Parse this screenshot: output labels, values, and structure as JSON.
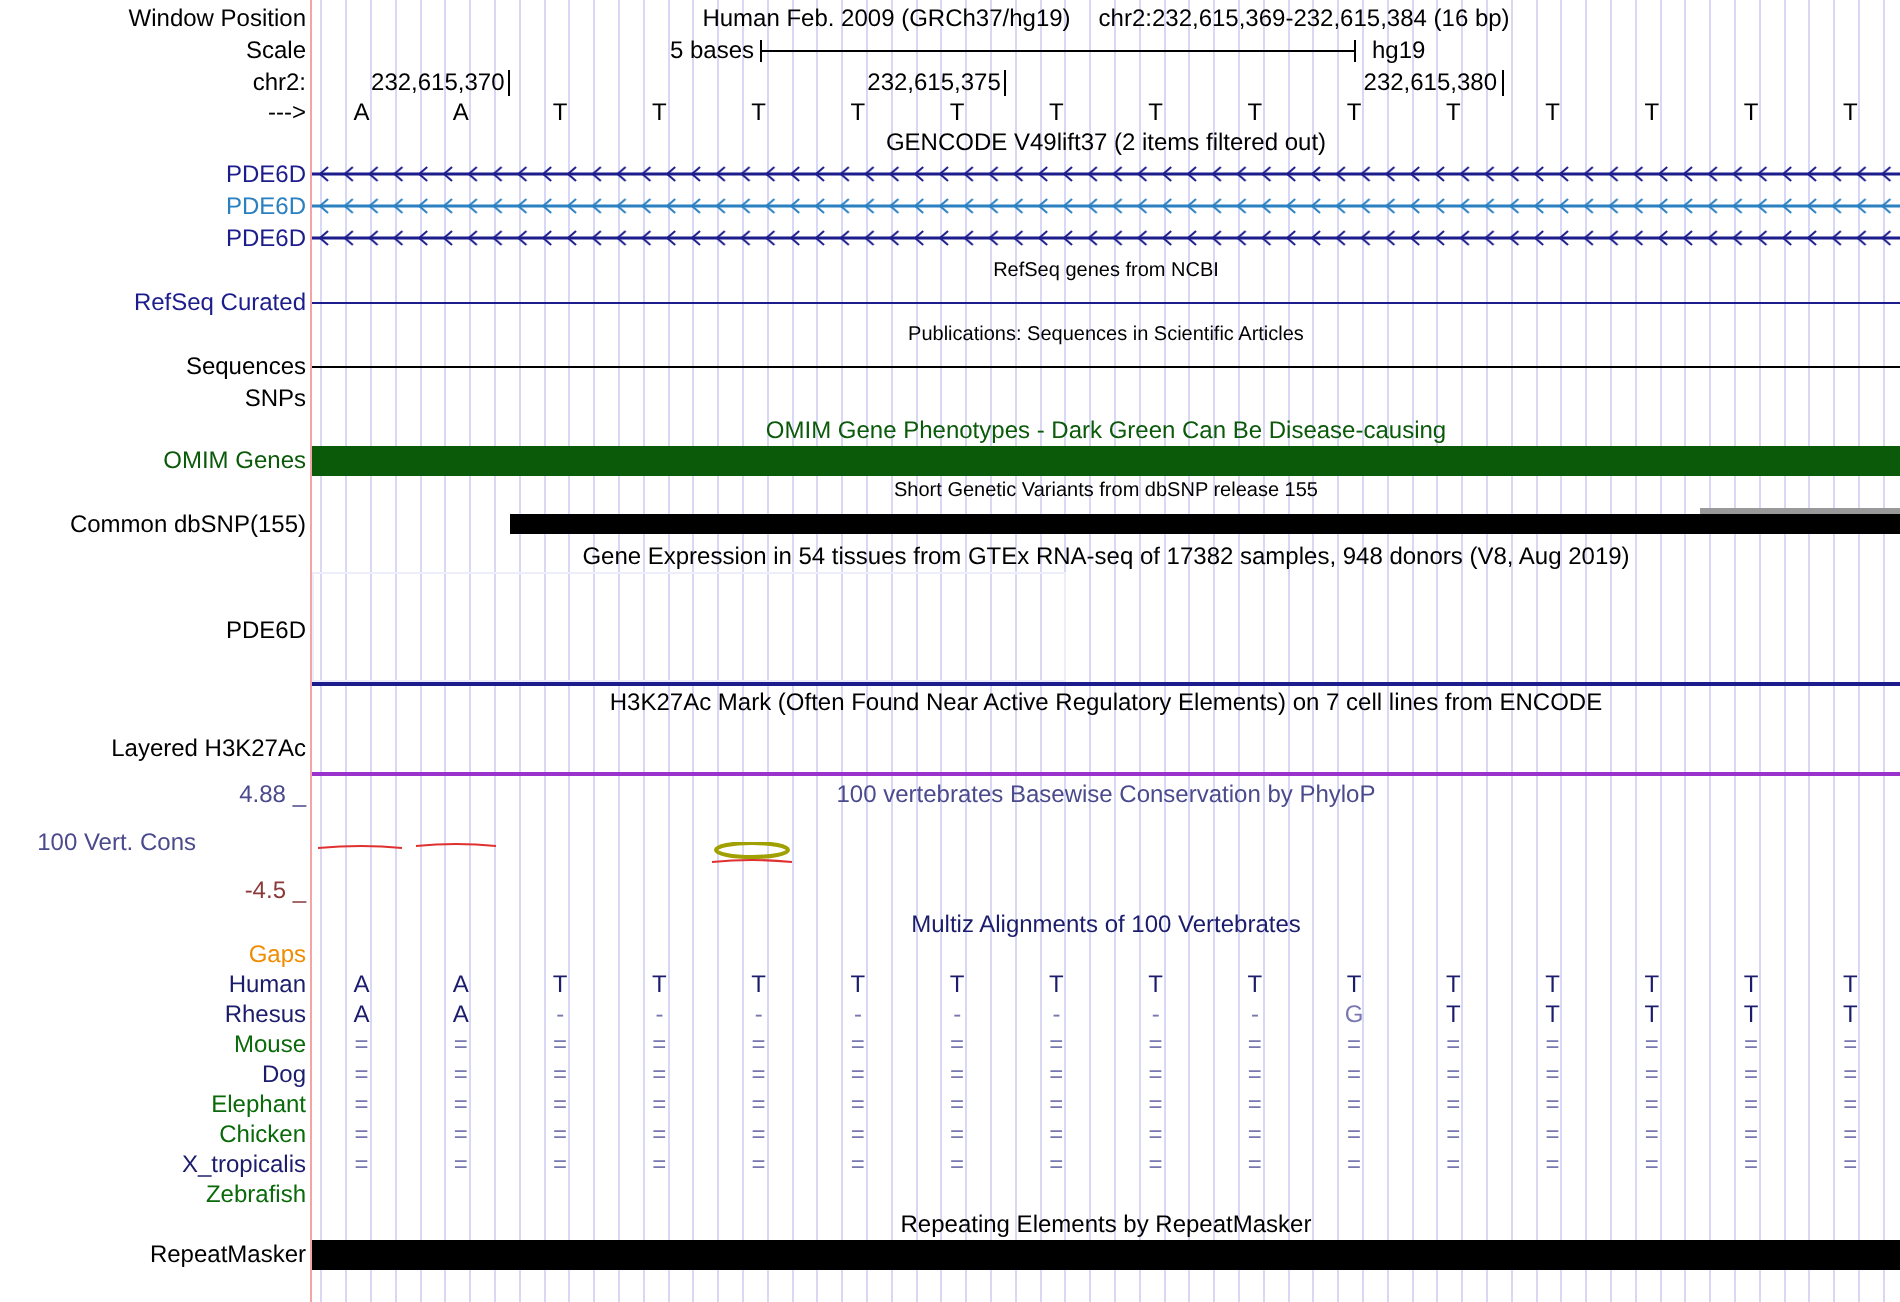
{
  "header": {
    "window_position_label": "Window Position",
    "assembly_title": "Human Feb. 2009 (GRCh37/hg19)",
    "position": "chr2:232,615,369-232,615,384 (16 bp)",
    "scale_label": "Scale",
    "scale_text": "5 bases",
    "assembly": "hg19",
    "chrom_label": "chr2:",
    "positions": [
      "232,615,370",
      "232,615,375",
      "232,615,380"
    ],
    "strand_label": "--->",
    "bases": [
      "A",
      "A",
      "T",
      "T",
      "T",
      "T",
      "T",
      "T",
      "T",
      "T",
      "T",
      "T",
      "T",
      "T",
      "T",
      "T"
    ]
  },
  "tracks": [
    {
      "kind": "gene",
      "title": "GENCODE V49lift37 (2 items filtered out)",
      "color": "#000000",
      "items": [
        {
          "label": "PDE6D",
          "color": "#1c1c8c"
        },
        {
          "label": "PDE6D",
          "color": "#2a80c0"
        },
        {
          "label": "PDE6D",
          "color": "#1c1c8c"
        }
      ]
    },
    {
      "kind": "line",
      "title": "RefSeq genes from NCBI",
      "color": "#000000",
      "rows": [
        {
          "label": "RefSeq Curated",
          "color": "#1c1c8c",
          "line": true
        }
      ]
    },
    {
      "kind": "line",
      "title": "Publications: Sequences in Scientific Articles",
      "color": "#000000",
      "rows": [
        {
          "label": "Sequences",
          "color": "#000000",
          "line": true
        },
        {
          "label": "SNPs",
          "color": "#000000",
          "line": false
        }
      ]
    },
    {
      "kind": "bar",
      "title": "OMIM Gene Phenotypes - Dark Green Can Be Disease-causing",
      "color": "#0a5a0a",
      "label": "OMIM Genes"
    },
    {
      "kind": "snp",
      "title": "Short Genetic Variants from dbSNP release 155",
      "color": "#000000",
      "label": "Common dbSNP(155)"
    },
    {
      "kind": "expression",
      "title": "Gene Expression in 54 tissues from GTEx RNA-seq of 17382 samples, 948 donors (V8, Aug 2019)",
      "color": "#000000",
      "label": "PDE6D"
    },
    {
      "kind": "signal",
      "title": "H3K27Ac Mark (Often Found Near Active Regulatory Elements) on 7 cell lines from ENCODE",
      "color": "#000000",
      "label": "Layered H3K27Ac"
    },
    {
      "kind": "conservation",
      "title": "100 vertebrates Basewise Conservation by PhyloP",
      "color": "#4a4a8c",
      "label": "100 Vert. Cons",
      "max_label": "4.88 _",
      "min_label": "-4.5 _"
    },
    {
      "kind": "alignment",
      "title": "Multiz Alignments of 100 Vertebrates",
      "color": "#1c1c6c",
      "gaps_label": "Gaps",
      "species": [
        {
          "label": "Human",
          "color": "#1c1c6c",
          "bases": [
            "A",
            "A",
            "T",
            "T",
            "T",
            "T",
            "T",
            "T",
            "T",
            "T",
            "T",
            "T",
            "T",
            "T",
            "T",
            "T"
          ]
        },
        {
          "label": "Rhesus",
          "color": "#1c1c6c",
          "bases": [
            "A",
            "A",
            "-",
            "-",
            "-",
            "-",
            "-",
            "-",
            "-",
            "-",
            "G",
            "T",
            "T",
            "T",
            "T",
            "T"
          ]
        },
        {
          "label": "Mouse",
          "color": "#0a6a0a",
          "bases": [
            "=",
            "=",
            "=",
            "=",
            "=",
            "=",
            "=",
            "=",
            "=",
            "=",
            "=",
            "=",
            "=",
            "=",
            "=",
            "="
          ]
        },
        {
          "label": "Dog",
          "color": "#1c1c6c",
          "bases": [
            "=",
            "=",
            "=",
            "=",
            "=",
            "=",
            "=",
            "=",
            "=",
            "=",
            "=",
            "=",
            "=",
            "=",
            "=",
            "="
          ]
        },
        {
          "label": "Elephant",
          "color": "#0a6a0a",
          "bases": [
            "=",
            "=",
            "=",
            "=",
            "=",
            "=",
            "=",
            "=",
            "=",
            "=",
            "=",
            "=",
            "=",
            "=",
            "=",
            "="
          ]
        },
        {
          "label": "Chicken",
          "color": "#0a6a0a",
          "bases": [
            "=",
            "=",
            "=",
            "=",
            "=",
            "=",
            "=",
            "=",
            "=",
            "=",
            "=",
            "=",
            "=",
            "=",
            "=",
            "="
          ]
        },
        {
          "label": "X_tropicalis",
          "color": "#1c1c6c",
          "bases": [
            "=",
            "=",
            "=",
            "=",
            "=",
            "=",
            "=",
            "=",
            "=",
            "=",
            "=",
            "=",
            "=",
            "=",
            "=",
            "="
          ]
        },
        {
          "label": "Zebrafish",
          "color": "#0a6a0a"
        }
      ]
    },
    {
      "kind": "bar",
      "title": "Repeating Elements by RepeatMasker",
      "color": "#000000",
      "label": "RepeatMasker"
    }
  ]
}
